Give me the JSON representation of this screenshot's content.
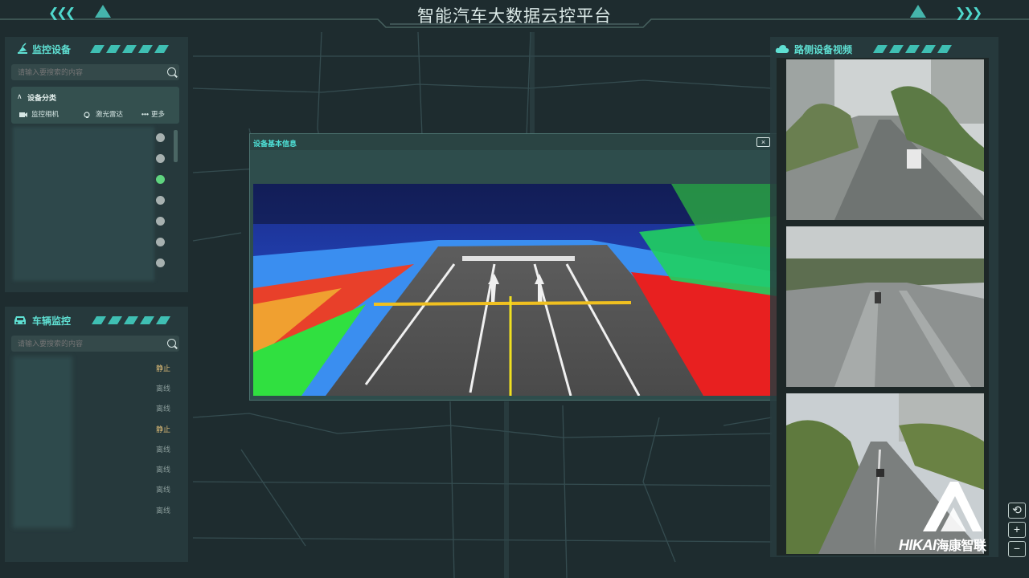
{
  "header": {
    "title": "智能汽车大数据云控平台"
  },
  "monitor_devices": {
    "title": "监控设备",
    "search_placeholder": "请输入要搜索的内容",
    "category_title": "设备分类",
    "categories": [
      {
        "label": "监控相机",
        "icon": "camera-icon"
      },
      {
        "label": "激光雷达",
        "icon": "lidar-icon"
      },
      {
        "label": "更多",
        "icon": "more-icon"
      }
    ],
    "device_status": [
      "offline",
      "offline",
      "online",
      "offline",
      "offline",
      "offline",
      "offline"
    ]
  },
  "vehicle_monitor": {
    "title": "车辆监控",
    "search_placeholder": "请输入要搜索的内容",
    "status": [
      "静止",
      "离线",
      "离线",
      "静止",
      "离线",
      "离线",
      "离线",
      "离线"
    ]
  },
  "modal": {
    "title": "设备基本信息",
    "close_label": "×"
  },
  "roadside_video": {
    "title": "路侧设备视频"
  },
  "logo": {
    "latin": "HIKAI",
    "chinese": "海康智联"
  },
  "map_controls": {
    "reset": "⟲",
    "zoom_in": "+",
    "zoom_out": "−"
  },
  "colors": {
    "accent": "#4fd8cc",
    "online": "#5fd47f",
    "idle": "#e6c27a",
    "offline": "#8a9c9a"
  }
}
